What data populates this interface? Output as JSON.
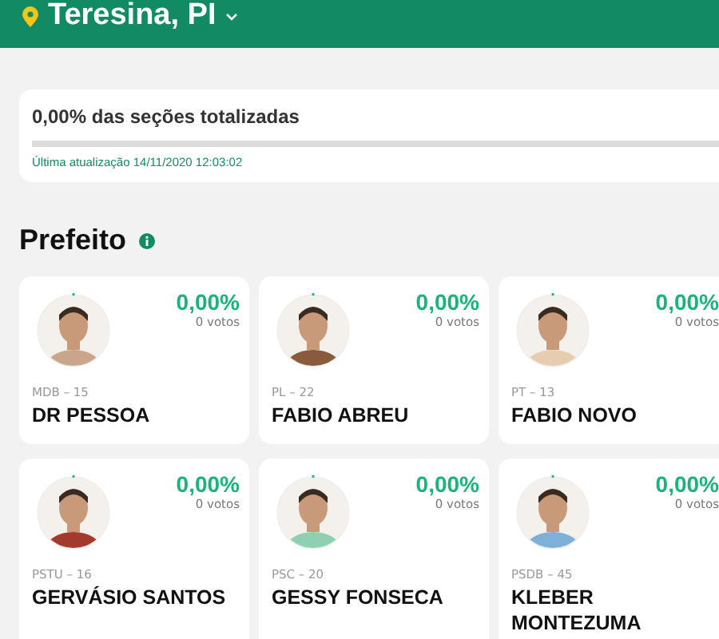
{
  "header": {
    "city": "Teresina, PI"
  },
  "progress": {
    "label": "0,00% das seções totalizadas",
    "level": 0,
    "updated": "Última atualização 14/11/2020 12:03:02"
  },
  "section": {
    "title": "Prefeito"
  },
  "candidates": [
    {
      "percent": "0,00%",
      "votes": "0 votos",
      "party": "MDB – 15",
      "name": "DR PESSOA"
    },
    {
      "percent": "0,00%",
      "votes": "0 votos",
      "party": "PL – 22",
      "name": "FABIO ABREU"
    },
    {
      "percent": "0,00%",
      "votes": "0 votos",
      "party": "PT – 13",
      "name": "FABIO NOVO"
    },
    {
      "percent": "0,00%",
      "votes": "0 votos",
      "party": "PSTU – 16",
      "name": "GERVÁSIO SANTOS"
    },
    {
      "percent": "0,00%",
      "votes": "0 votos",
      "party": "PSC – 20",
      "name": "GESSY FONSECA"
    },
    {
      "percent": "0,00%",
      "votes": "0 votos",
      "party": "PSDB – 45",
      "name": "KLEBER MONTEZUMA"
    }
  ]
}
